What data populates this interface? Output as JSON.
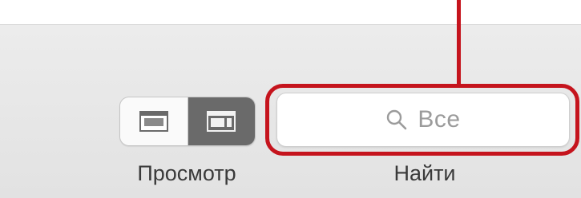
{
  "toolbar": {
    "view_control": {
      "label": "Просмотр",
      "options": [
        {
          "icon": "layout-single-icon",
          "selected": false
        },
        {
          "icon": "layout-split-icon",
          "selected": true
        }
      ]
    },
    "search": {
      "label": "Найти",
      "placeholder": "Все",
      "icon": "search-icon"
    }
  },
  "annotation": {
    "target": "search",
    "color": "#c5141d"
  },
  "colors": {
    "toolbar_bg": "#e6e6e6",
    "segment_selected": "#6a6a6a",
    "segment_unselected": "#fafafa",
    "placeholder": "#9b9b9b",
    "label": "#3a3a3a",
    "accent_red": "#c5141d"
  }
}
